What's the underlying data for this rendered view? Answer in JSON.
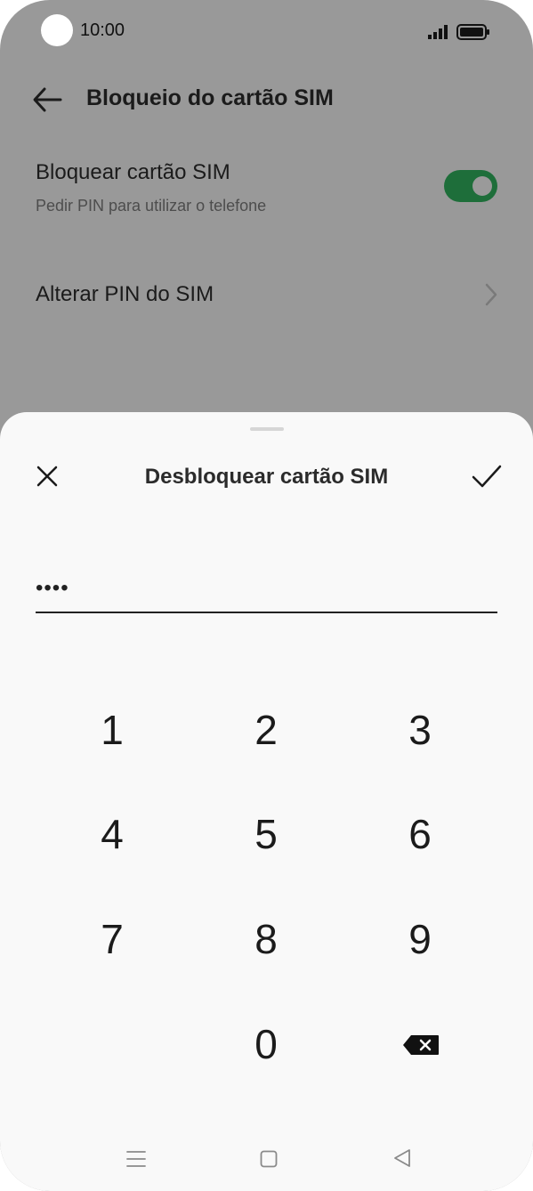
{
  "status_bar": {
    "time": "10:00"
  },
  "header": {
    "title": "Bloqueio do cartão SIM"
  },
  "settings": {
    "lock_sim": {
      "title": "Bloquear cartão SIM",
      "subtitle": "Pedir PIN para utilizar o telefone",
      "enabled": true
    },
    "change_pin": {
      "label": "Alterar PIN do SIM"
    }
  },
  "dialog": {
    "title": "Desbloquear cartão SIM",
    "pin_value": "••••"
  },
  "keypad": {
    "keys": [
      "1",
      "2",
      "3",
      "4",
      "5",
      "6",
      "7",
      "8",
      "9",
      "0"
    ]
  },
  "colors": {
    "toggle_on": "#1e6e3a",
    "sheet_bg": "#f9f9f9",
    "dim_bg": "#999999"
  }
}
